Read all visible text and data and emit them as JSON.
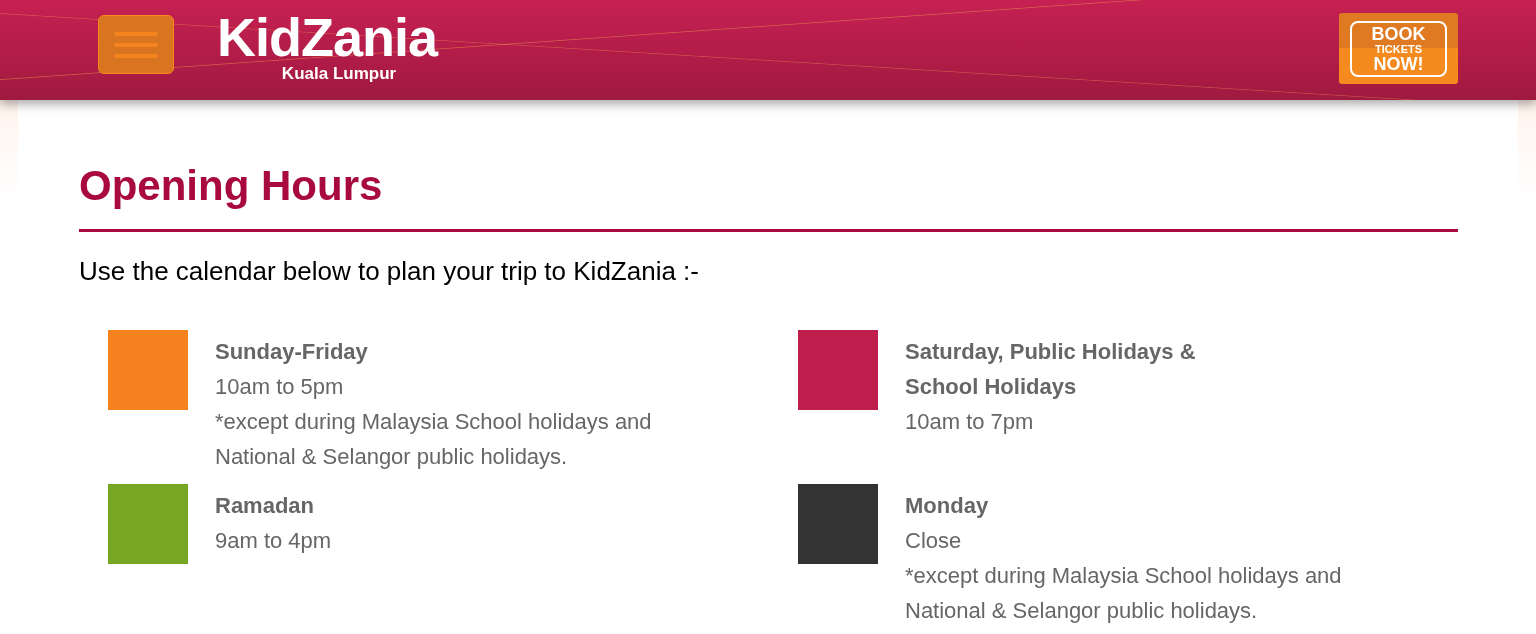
{
  "header": {
    "logo": {
      "name": "KidZania",
      "location": "Kuala Lumpur"
    },
    "book_button": {
      "lines": [
        "BOOK",
        "TICKETS",
        "NOW!"
      ]
    }
  },
  "page": {
    "title": "Opening Hours",
    "intro": "Use the calendar below to plan your trip to KidZania :-"
  },
  "legend": [
    {
      "color": "#f5821f",
      "heading": [
        "Sunday-Friday"
      ],
      "hours": "10am to 5pm",
      "note": "*except during Malaysia School holidays and National & Selangor public holidays."
    },
    {
      "color": "#c01f4e",
      "heading": [
        "Saturday, Public Holidays &",
        "School Holidays"
      ],
      "hours": "10am to 7pm"
    },
    {
      "color": "#76a623",
      "heading": [
        "Ramadan"
      ],
      "hours": "9am to 4pm"
    },
    {
      "color": "#333333",
      "heading": [
        "Monday"
      ],
      "hours": "Close",
      "note": "*except during Malaysia School holidays and National & Selangor public holidays."
    }
  ]
}
